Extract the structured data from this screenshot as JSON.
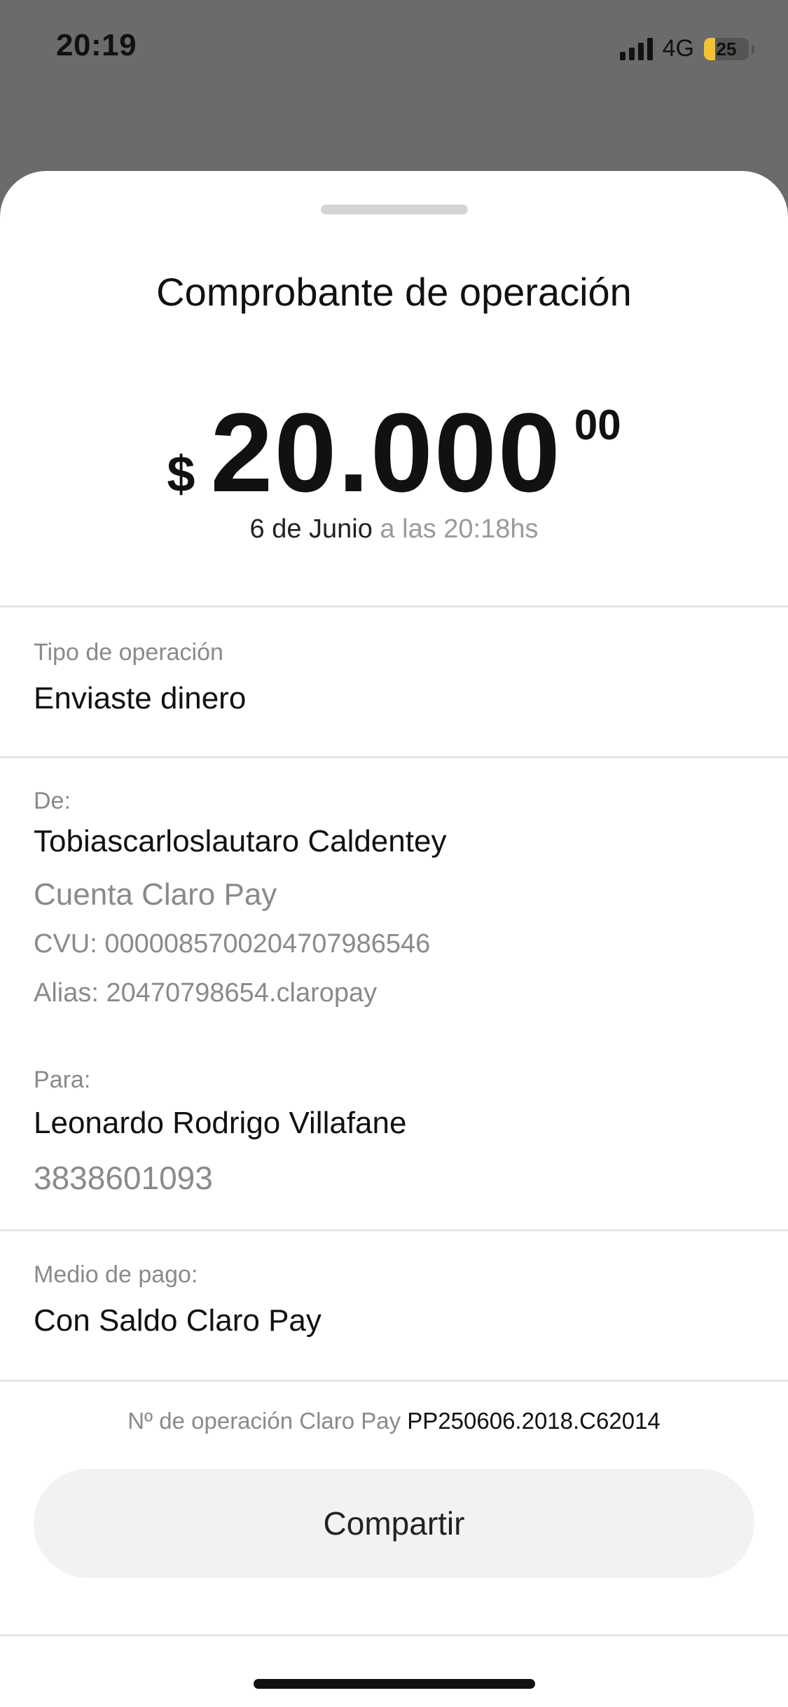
{
  "status_bar": {
    "time": "20:19",
    "network": "4G",
    "battery_level": "25",
    "battery_color": "#f2c230"
  },
  "sheet": {
    "title": "Comprobante de operación",
    "amount": {
      "currency": "$",
      "integer": "20.000",
      "cents": "00"
    },
    "date": {
      "main": "6 de Junio",
      "time": " a las 20:18hs"
    },
    "operation_type": {
      "label": "Tipo de operación",
      "value": "Enviaste dinero"
    },
    "from": {
      "label": "De:",
      "name": "Tobiascarloslautaro Caldentey",
      "account": "Cuenta Claro Pay",
      "cvu": "CVU: 0000085700204707986546",
      "alias": "Alias: 20470798654.claropay"
    },
    "to": {
      "label": "Para:",
      "name": "Leonardo Rodrigo Villafane",
      "phone": "3838601093"
    },
    "payment_method": {
      "label": "Medio de pago:",
      "value": "Con Saldo Claro Pay"
    },
    "operation_number": {
      "label": "Nº de operación Claro Pay ",
      "value": "PP250606.2018.C62014"
    },
    "share_button": "Compartir"
  }
}
